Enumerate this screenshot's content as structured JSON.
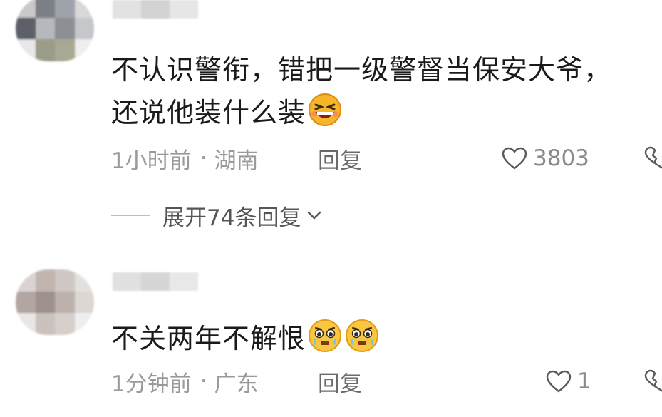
{
  "comments": [
    {
      "text": "不认识警衔，错把一级警督当保安大爷，还说他装什么装",
      "emoji": "laughing-emoji",
      "time": "1小时前",
      "location": "湖南",
      "reply_label": "回复",
      "likes": "3803",
      "expand_label": "展开74条回复"
    },
    {
      "text": "不关两年不解恨",
      "emoji": "teary-emoji",
      "time": "1分钟前",
      "location": "广东",
      "reply_label": "回复",
      "likes": "1"
    }
  ],
  "colors": {
    "text_main": "#1a1a1a",
    "text_meta": "#9a9a9a",
    "reply": "#6a6a6a"
  }
}
